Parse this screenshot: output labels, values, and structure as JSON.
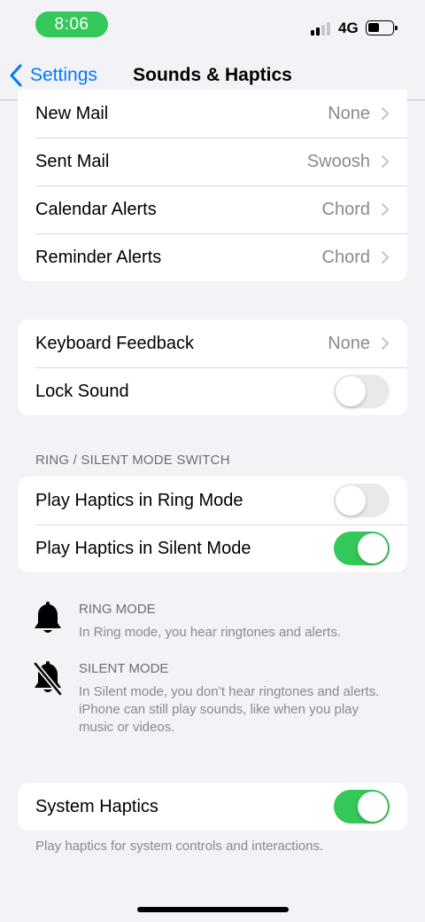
{
  "status_bar": {
    "time": "8:06",
    "network": "4G"
  },
  "nav": {
    "back_label": "Settings",
    "title": "Sounds & Haptics"
  },
  "group1": {
    "rows": [
      {
        "label": "New Mail",
        "value": "None"
      },
      {
        "label": "Sent Mail",
        "value": "Swoosh"
      },
      {
        "label": "Calendar Alerts",
        "value": "Chord"
      },
      {
        "label": "Reminder Alerts",
        "value": "Chord"
      }
    ]
  },
  "group2": {
    "keyboard_feedback": {
      "label": "Keyboard Feedback",
      "value": "None"
    },
    "lock_sound": {
      "label": "Lock Sound",
      "enabled": false
    }
  },
  "ring_silent": {
    "header": "RING / SILENT MODE SWITCH",
    "play_haptics_ring": {
      "label": "Play Haptics in Ring Mode",
      "enabled": false
    },
    "play_haptics_silent": {
      "label": "Play Haptics in Silent Mode",
      "enabled": true
    }
  },
  "info": {
    "ring_mode": {
      "title": "RING MODE",
      "text": "In Ring mode, you hear ringtones and alerts.",
      "icon": "bell-icon"
    },
    "silent_mode": {
      "title": "SILENT MODE",
      "text": "In Silent mode, you don’t hear ringtones and alerts. iPhone can still play sounds, like when you play music or videos.",
      "icon": "bell-slash-icon"
    }
  },
  "system_haptics": {
    "label": "System Haptics",
    "enabled": true,
    "footer": "Play haptics for system controls and interactions."
  },
  "colors": {
    "accent": "#007aff",
    "toggle_on": "#34c759",
    "time_pill": "#34c759",
    "background": "#f2f2f7"
  }
}
